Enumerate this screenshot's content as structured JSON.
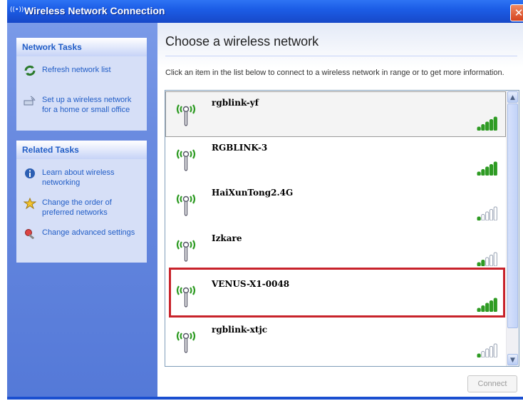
{
  "window": {
    "title": "Wireless Network Connection",
    "title_icon": "((•))",
    "close_glyph": "✕"
  },
  "network_tasks": {
    "heading": "Network Tasks",
    "items": [
      {
        "label": "Refresh network list",
        "icon": "refresh-icon"
      },
      {
        "label": "Set up a wireless network for a home or small office",
        "icon": "setup-network-icon"
      }
    ]
  },
  "related_tasks": {
    "heading": "Related Tasks",
    "items": [
      {
        "label": "Learn about wireless networking",
        "icon": "info-icon"
      },
      {
        "label": "Change the order of preferred networks",
        "icon": "star-icon"
      },
      {
        "label": "Change advanced settings",
        "icon": "settings-icon"
      }
    ]
  },
  "main": {
    "heading": "Choose a wireless network",
    "description": "Click an item in the list below to connect to a wireless network in range or to get more information."
  },
  "networks": [
    {
      "name": "rgblink-yf",
      "bars": 5
    },
    {
      "name": "RGBLINK-3",
      "bars": 5
    },
    {
      "name": "HaiXunTong2.4G",
      "bars": 1
    },
    {
      "name": "Izkare",
      "bars": 2
    },
    {
      "name": "VENUS-X1-0048",
      "bars": 5
    },
    {
      "name": "rgblink-xtjc",
      "bars": 1
    }
  ],
  "connect_label": "Connect",
  "colors": {
    "accent": "#215dc6",
    "signal_on": "#2e9b23",
    "highlight": "#c8232b"
  }
}
